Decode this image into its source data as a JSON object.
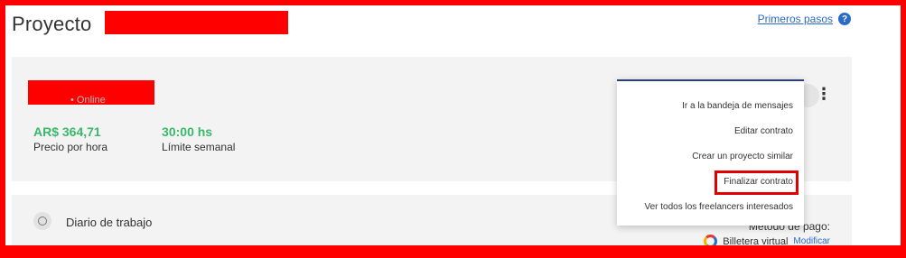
{
  "page_title": "Proyecto",
  "help": {
    "label": "Primeros pasos",
    "icon": "question-icon",
    "icon_glyph": "?"
  },
  "freelancer": {
    "status": "• Online",
    "rate": {
      "value": "AR$ 364,71",
      "label": "Precio por hora"
    },
    "limit": {
      "value": "30:00 hs",
      "label": "Límite semanal"
    }
  },
  "menu": {
    "items": [
      "Ir a la bandeja de mensajes",
      "Editar contrato",
      "Crear un proyecto similar",
      "Finalizar contrato",
      "Ver todos los freelancers interesados"
    ]
  },
  "worklog": {
    "label": "Diario de trabajo"
  },
  "payment": {
    "label": "Metodo de pago:",
    "method": "Billetera virtual",
    "modify": "Modificar"
  },
  "colors": {
    "accent": "#2a6ac8",
    "green": "#3ab86a",
    "redaction": "#ff0000"
  }
}
